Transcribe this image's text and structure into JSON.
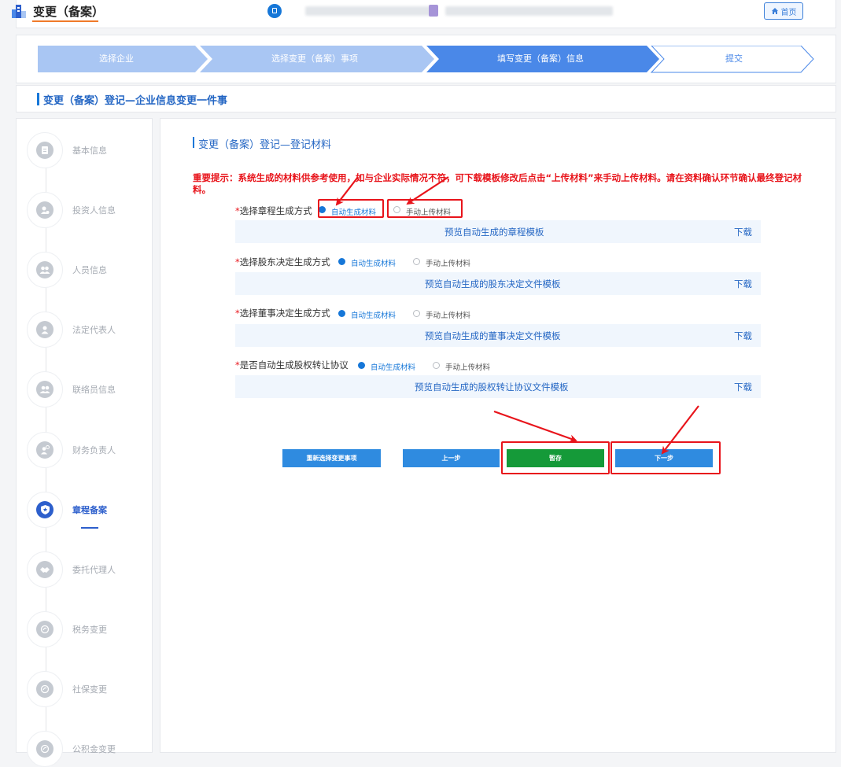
{
  "header": {
    "title": "变更（备案）",
    "home_label": "首页"
  },
  "steps": [
    {
      "label": "选择企业",
      "state": "done"
    },
    {
      "label": "选择变更（备案）事项",
      "state": "done"
    },
    {
      "label": "填写变更（备案）信息",
      "state": "current"
    },
    {
      "label": "提交",
      "state": "pending"
    }
  ],
  "breadcrumb": "变更（备案）登记—企业信息变更一件事",
  "sidebar": {
    "items": [
      {
        "label": "基本信息",
        "icon": "document-icon",
        "active": false
      },
      {
        "label": "投资人信息",
        "icon": "investor-icon",
        "active": false
      },
      {
        "label": "人员信息",
        "icon": "people-icon",
        "active": false
      },
      {
        "label": "法定代表人",
        "icon": "person-icon",
        "active": false
      },
      {
        "label": "联络员信息",
        "icon": "contact-icon",
        "active": false
      },
      {
        "label": "财务负责人",
        "icon": "finance-person-icon",
        "active": false
      },
      {
        "label": "章程备案",
        "icon": "shield-star-icon",
        "active": true
      },
      {
        "label": "委托代理人",
        "icon": "handshake-icon",
        "active": false
      },
      {
        "label": "税务变更",
        "icon": "tax-icon",
        "active": false
      },
      {
        "label": "社保变更",
        "icon": "social-security-icon",
        "active": false
      },
      {
        "label": "公积金变更",
        "icon": "fund-icon",
        "active": false
      }
    ]
  },
  "main": {
    "section_title": "变更（备案）登记—登记材料",
    "notice": "重要提示：系统生成的材料供参考使用，如与企业实际情况不符，可下载模板修改后点击“上传材料”来手动上传材料。请在资料确认环节确认最终登记材料。",
    "questions": [
      {
        "label": "选择章程生成方式",
        "auto_label": "自动生成材料",
        "manual_label": "手动上传材料",
        "selected": "auto",
        "preview": "预览自动生成的章程模板",
        "download": "下载"
      },
      {
        "label": "选择股东决定生成方式",
        "auto_label": "自动生成材料",
        "manual_label": "手动上传材料",
        "selected": "auto",
        "preview": "预览自动生成的股东决定文件模板",
        "download": "下载"
      },
      {
        "label": "选择董事决定生成方式",
        "auto_label": "自动生成材料",
        "manual_label": "手动上传材料",
        "selected": "auto",
        "preview": "预览自动生成的董事决定文件模板",
        "download": "下载"
      },
      {
        "label": "是否自动生成股权转让协议",
        "auto_label": "自动生成材料",
        "manual_label": "手动上传材料",
        "selected": "auto",
        "preview": "预览自动生成的股权转让协议文件模板",
        "download": "下载"
      }
    ],
    "buttons": {
      "reselect": "重新选择变更事项",
      "prev": "上一步",
      "save": "暂存",
      "next": "下一步"
    }
  },
  "colors": {
    "primary": "#1677d8",
    "step_done": "#a9c6f3",
    "step_current": "#4a88e8",
    "save_green": "#159a39",
    "annotation_red": "#e8141b"
  }
}
